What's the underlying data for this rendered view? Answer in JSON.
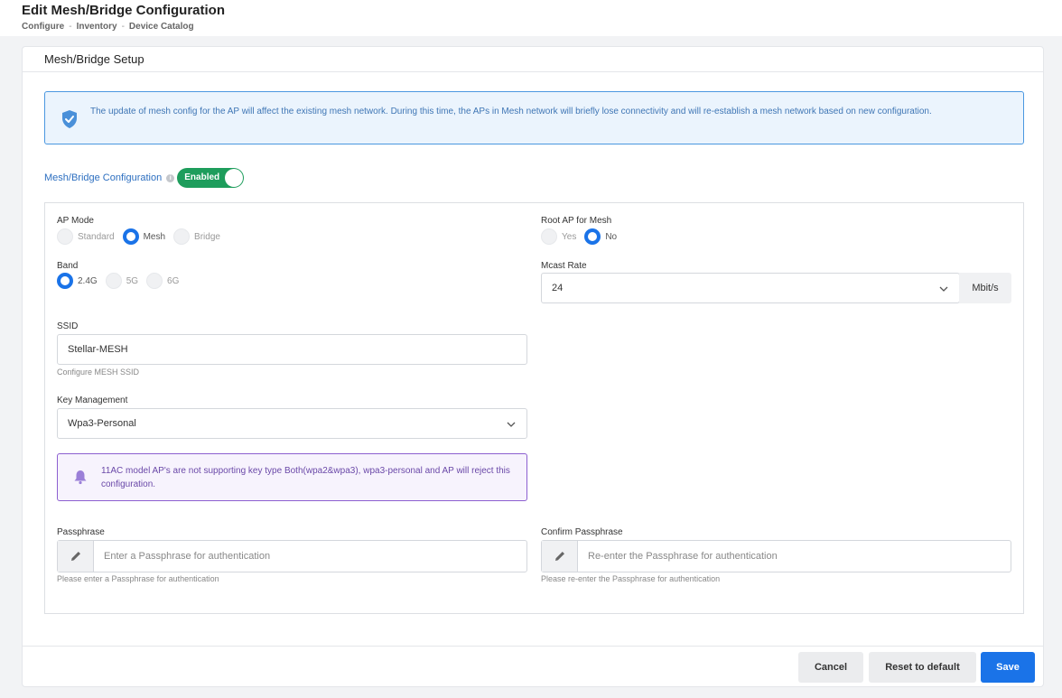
{
  "header": {
    "title": "Edit Mesh/Bridge Configuration",
    "breadcrumb": [
      "Configure",
      "Inventory",
      "Device Catalog"
    ],
    "separator": "-"
  },
  "card": {
    "title": "Mesh/Bridge Setup"
  },
  "info_alert": {
    "icon": "shield-check-icon",
    "text": "The update of mesh config for the AP will affect the existing mesh network. During this time, the APs in Mesh network will briefly lose connectivity and will re-establish a mesh network based on new configuration."
  },
  "mesh_config": {
    "label": "Mesh/Bridge Configuration",
    "info_glyph": "i",
    "toggle_label": "Enabled",
    "toggle_on": true
  },
  "form": {
    "ap_mode": {
      "label": "AP Mode",
      "options": [
        "Standard",
        "Mesh",
        "Bridge"
      ],
      "selected": "Mesh"
    },
    "root_ap": {
      "label": "Root AP for Mesh",
      "options": [
        "Yes",
        "No"
      ],
      "selected": "No"
    },
    "band": {
      "label": "Band",
      "options": [
        "2.4G",
        "5G",
        "6G"
      ],
      "selected": "2.4G"
    },
    "mcast_rate": {
      "label": "Mcast Rate",
      "value": "24",
      "unit": "Mbit/s"
    },
    "ssid": {
      "label": "SSID",
      "value": "Stellar-MESH",
      "hint": "Configure MESH SSID"
    },
    "key_management": {
      "label": "Key Management",
      "value": "Wpa3-Personal"
    },
    "warning": {
      "icon": "bell-icon",
      "text": "11AC model AP's are not supporting key type Both(wpa2&wpa3), wpa3-personal and AP will reject this configuration."
    },
    "passphrase": {
      "label": "Passphrase",
      "placeholder": "Enter a Passphrase for authentication",
      "hint": "Please enter a Passphrase for authentication"
    },
    "confirm_passphrase": {
      "label": "Confirm Passphrase",
      "placeholder": "Re-enter the Passphrase for authentication",
      "hint": "Please re-enter the Passphrase for authentication"
    }
  },
  "footer": {
    "cancel": "Cancel",
    "reset": "Reset to default",
    "save": "Save"
  },
  "colors": {
    "accent": "#1a73e8",
    "success": "#1e9d5c",
    "info_border": "#4a97e0",
    "warn_border": "#8c5fd0"
  }
}
